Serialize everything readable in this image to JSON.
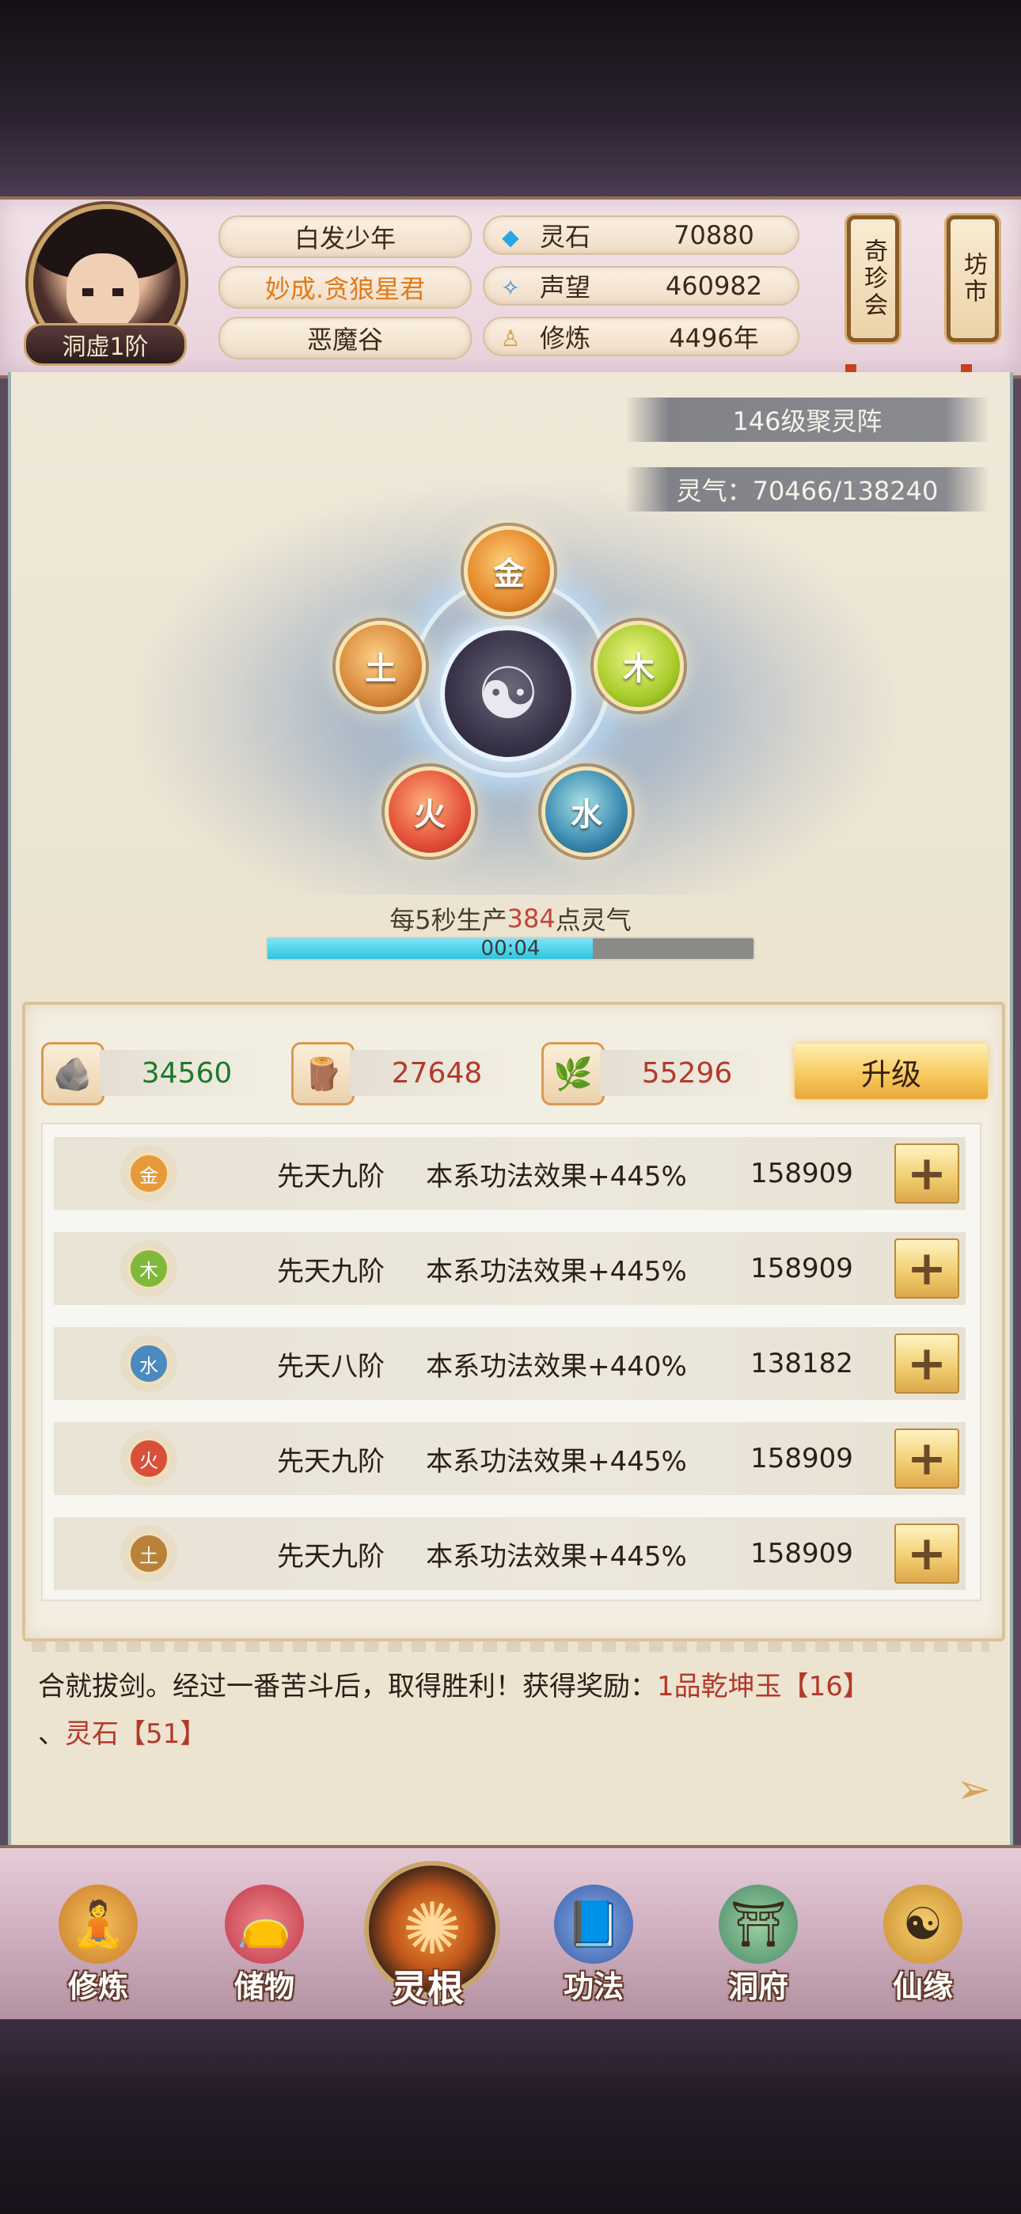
{
  "header": {
    "player_name": "白发少年",
    "title": "妙成.贪狼星君",
    "sect": "恶魔谷",
    "realm": "洞虚1阶",
    "stats": [
      {
        "label": "灵石",
        "value": "70880",
        "icon": "spirit-stone-icon"
      },
      {
        "label": "声望",
        "value": "460982",
        "icon": "prestige-icon"
      },
      {
        "label": "修炼",
        "value": "4496年",
        "icon": "cultivation-icon"
      }
    ],
    "buttons": {
      "treasure": "奇珍会",
      "market": "坊市"
    }
  },
  "formation": {
    "level_label": "146级聚灵阵",
    "qi_label": "灵气：70466/138240",
    "elements": [
      "金",
      "木",
      "水",
      "火",
      "土"
    ],
    "produce_prefix": "每5秒生产",
    "produce_value": "384",
    "produce_suffix": "点灵气",
    "timer": "00:04",
    "timer_progress": 0.67
  },
  "upgrade_panel": {
    "resources": [
      {
        "icon": "ore-icon",
        "value": "34560",
        "color": "#1e7a2a"
      },
      {
        "icon": "wood-icon",
        "value": "27648",
        "color": "#b23a2a"
      },
      {
        "icon": "herb-icon",
        "value": "55296",
        "color": "#b23a2a"
      }
    ],
    "upgrade_label": "升级",
    "rows": [
      {
        "element": "金",
        "rank": "先天九阶",
        "effect": "本系功法效果+445%",
        "cost": "158909",
        "color": "#e69a3a"
      },
      {
        "element": "木",
        "rank": "先天九阶",
        "effect": "本系功法效果+445%",
        "cost": "158909",
        "color": "#7fb83a"
      },
      {
        "element": "水",
        "rank": "先天八阶",
        "effect": "本系功法效果+440%",
        "cost": "138182",
        "color": "#4a8ac0"
      },
      {
        "element": "火",
        "rank": "先天九阶",
        "effect": "本系功法效果+445%",
        "cost": "158909",
        "color": "#d8503a"
      },
      {
        "element": "土",
        "rank": "先天九阶",
        "effect": "本系功法效果+445%",
        "cost": "158909",
        "color": "#b8823a"
      }
    ],
    "plus_label": "+"
  },
  "log": {
    "text_before": "合就拔剑。经过一番苦斗后，取得胜利！获得奖励：",
    "reward_1": "1品乾坤玉【16】",
    "separator": "、",
    "reward_2": "灵石【51】"
  },
  "nav": [
    {
      "label": "修炼",
      "icon": "cultivate-icon"
    },
    {
      "label": "储物",
      "icon": "storage-bag-icon"
    },
    {
      "label": "灵根",
      "icon": "spirit-root-icon"
    },
    {
      "label": "功法",
      "icon": "technique-book-icon"
    },
    {
      "label": "洞府",
      "icon": "cave-dwelling-icon"
    },
    {
      "label": "仙缘",
      "icon": "immortal-fate-icon"
    }
  ]
}
